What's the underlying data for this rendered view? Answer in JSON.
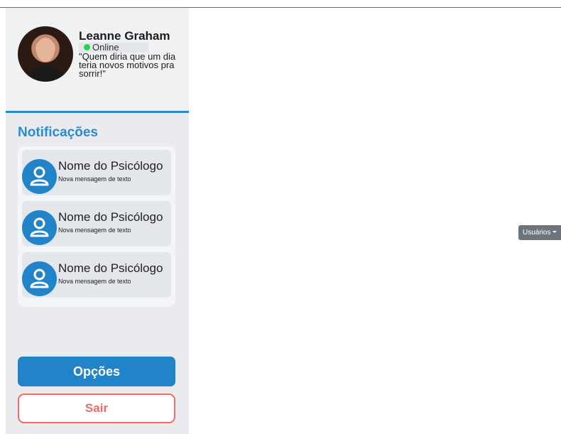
{
  "profile": {
    "name": "Leanne Graham",
    "status": "Online",
    "quote": "\"Quem diria que um dia teria novos motivos pra sorrir!\"",
    "status_color": "#27d74a"
  },
  "notifications": {
    "title": "Notificações",
    "items": [
      {
        "name": "Nome do Psicólogo",
        "message": "Nova mensagem de texto",
        "icon": "user-icon"
      },
      {
        "name": "Nome do Psicólogo",
        "message": "Nova mensagem de texto",
        "icon": "user-icon"
      },
      {
        "name": "Nome do Psicólogo",
        "message": "Nova mensagem de texto",
        "icon": "user-icon"
      }
    ]
  },
  "actions": {
    "options_label": "Opções",
    "exit_label": "Sair"
  },
  "users_dropdown": {
    "label": "Usuários",
    "icon": "caret-down-icon"
  },
  "colors": {
    "accent": "#2183c8",
    "danger": "#ef6b6b",
    "dropdown": "#6c757d"
  }
}
